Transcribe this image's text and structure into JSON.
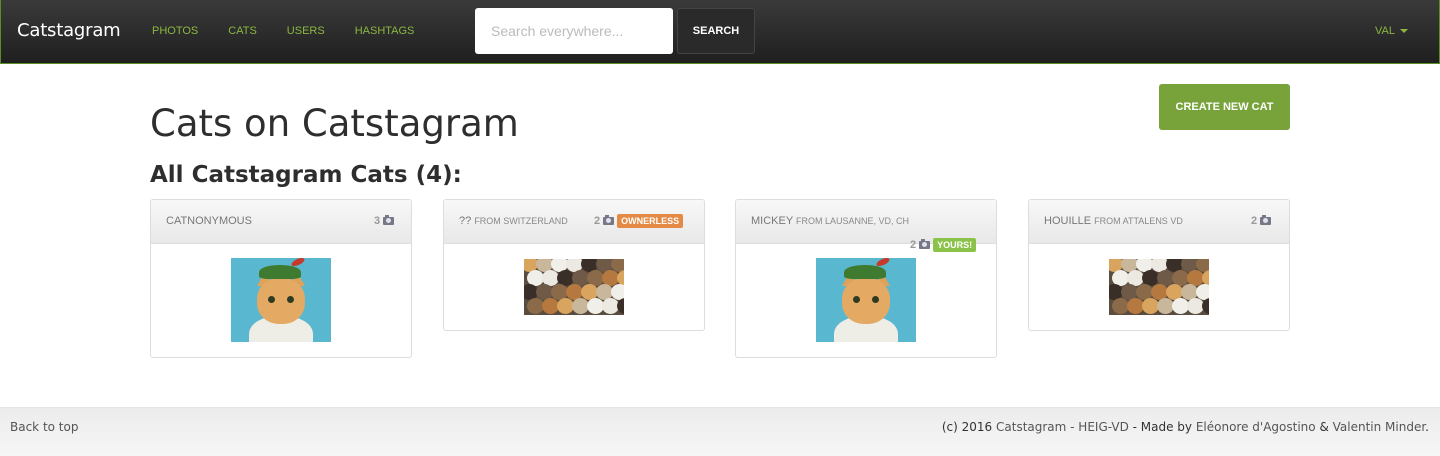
{
  "navbar": {
    "brand": "Catstagram",
    "links": [
      "PHOTOS",
      "CATS",
      "USERS",
      "HASHTAGS"
    ],
    "search_placeholder": "Search everywhere...",
    "search_button": "SEARCH",
    "user": "VAL"
  },
  "header": {
    "title": "Cats on Catstagram",
    "create_button": "CREATE NEW CAT",
    "section_title": "All Catstagram Cats (4):"
  },
  "cats": [
    {
      "name": "CATNONYMOUS",
      "from": "",
      "photos": "3",
      "badge": "",
      "image": "tabby-with-hat"
    },
    {
      "name": "??",
      "from": "FROM SWITZERLAND",
      "photos": "2",
      "badge": "OWNERLESS",
      "image": "cat-crowd"
    },
    {
      "name": "MICKEY",
      "from": "FROM LAUSANNE, VD, CH",
      "photos": "2",
      "badge": "YOURS!",
      "image": "tabby-with-hat"
    },
    {
      "name": "HOUILLE",
      "from": "FROM ATTALENS VD",
      "photos": "2",
      "badge": "",
      "image": "cat-crowd"
    }
  ],
  "footer": {
    "back_to_top": "Back to top",
    "copyright": "(c) 2016",
    "site_link": "Catstagram - HEIG-VD",
    "made_by": " - Made by ",
    "author1": "Eléonore d'Agostino",
    "amp": " & ",
    "author2": "Valentin Minder",
    "end": "."
  },
  "colors": {
    "accent": "#77a33a",
    "nav_link": "#8bb73f",
    "badge_orange": "#e58a44",
    "badge_green": "#8bc34a"
  }
}
